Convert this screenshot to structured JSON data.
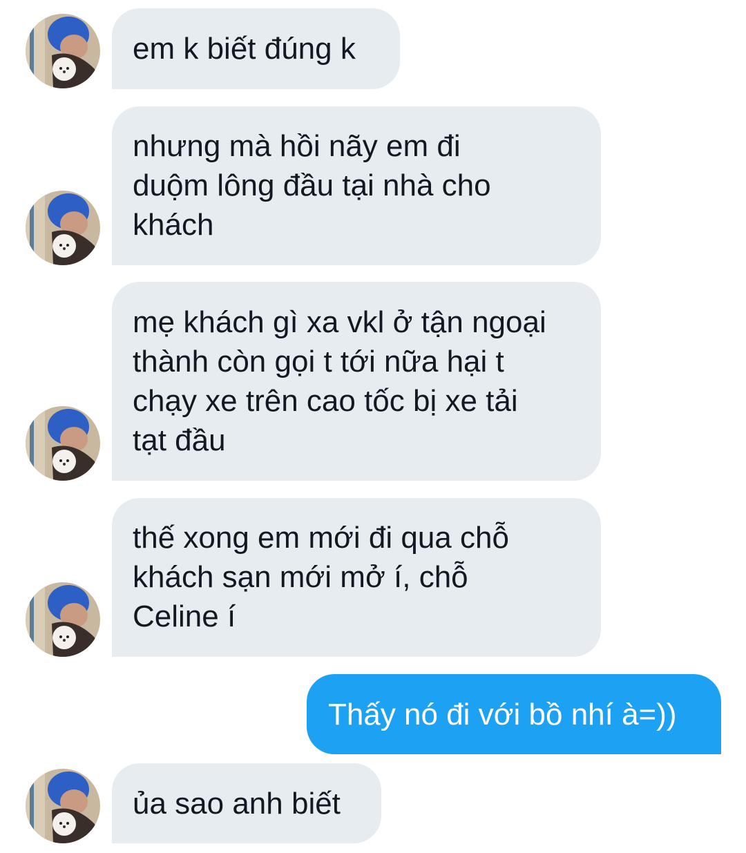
{
  "conversation": {
    "messages": [
      {
        "direction": "incoming",
        "text": "em k biết đúng k"
      },
      {
        "direction": "incoming",
        "text": "nhưng mà hồi nãy em đi\nduộm lông đầu tại nhà cho\nkhách"
      },
      {
        "direction": "incoming",
        "text": "mẹ khách gì xa vkl ở tận ngoại\nthành còn gọi t tới nữa hại t\nchạy xe trên cao tốc bị xe tải\ntạt đầu"
      },
      {
        "direction": "incoming",
        "text": "thế xong em mới đi qua chỗ\nkhách sạn mới mở í, chỗ\nCeline í"
      },
      {
        "direction": "outgoing",
        "text": "Thấy nó đi với bồ nhí à=))"
      },
      {
        "direction": "incoming",
        "text": "ủa sao anh biết"
      }
    ]
  },
  "colors": {
    "incoming_bubble": "#e6ecf0",
    "incoming_text": "#141823",
    "outgoing_bubble": "#1da1f2",
    "outgoing_text": "#ffffff",
    "background": "#ffffff"
  },
  "icons": {
    "avatar": "avatar-image"
  }
}
